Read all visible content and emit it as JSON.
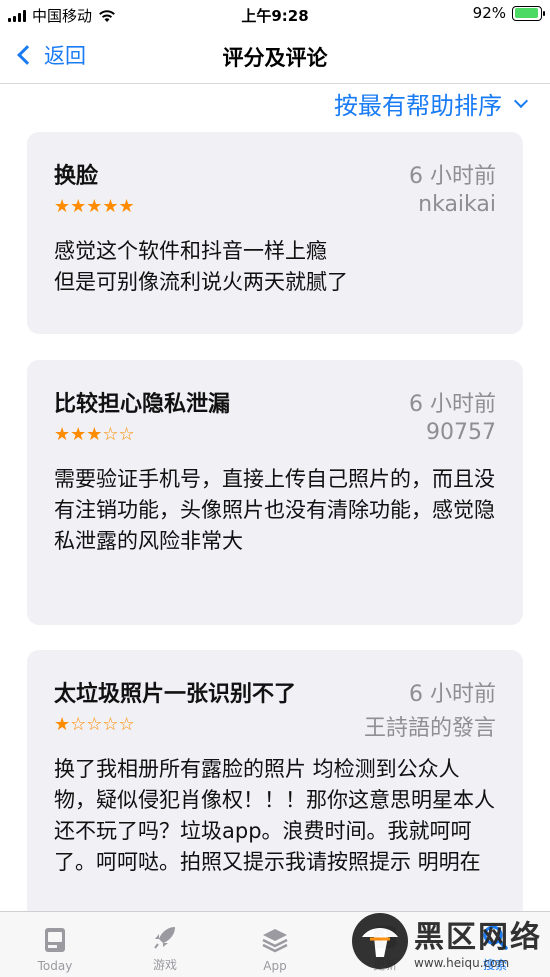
{
  "status_bar": {
    "carrier": "中国移动",
    "time": "上午9:28",
    "battery": "92%",
    "battery_level": 0.92,
    "battery_color": "#4cd964"
  },
  "nav": {
    "back_label": "返回",
    "title": "评分及评论"
  },
  "sort": {
    "label": "按最有帮助排序"
  },
  "accent_color": "#1a7cf5",
  "star_color": "#ff8c00",
  "reviews": [
    {
      "title": "换脸",
      "time": "6 小时前",
      "author": "nkaikai",
      "rating": 5,
      "stars": "★★★★★",
      "body": "感觉这个软件和抖音一样上瘾\n但是可别像流利说火两天就腻了"
    },
    {
      "title": "比较担心隐私泄漏",
      "time": "6 小时前",
      "author": "90757",
      "rating": 3,
      "stars": "★★★☆☆",
      "body": "需要验证手机号，直接上传自己照片的，而且没有注销功能，头像照片也没有清除功能，感觉隐私泄露的风险非常大"
    },
    {
      "title": "太垃圾照片一张识别不了",
      "time": "6 小时前",
      "author": "王詩語的發言",
      "rating": 1,
      "stars": "★☆☆☆☆",
      "body": "换了我相册所有露脸的照片 均检测到公众人物，疑似侵犯肖像权！！！那你这意思明星本人还不玩了吗？垃圾app。浪费时间。我就呵呵了。呵呵哒。拍照又提示我请按照提示 明明在"
    }
  ],
  "tabs": [
    {
      "label": "Today",
      "icon": "today-icon"
    },
    {
      "label": "游戏",
      "icon": "rocket-icon"
    },
    {
      "label": "App",
      "icon": "layers-icon"
    },
    {
      "label": "更新",
      "icon": "download-icon"
    },
    {
      "label": "搜索",
      "icon": "search-icon"
    }
  ],
  "watermark": {
    "text": "黑区网络",
    "url": "www.heiqu.com"
  }
}
